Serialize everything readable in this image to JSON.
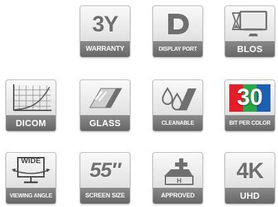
{
  "tiles": [
    {
      "id": "warranty",
      "title": "3Y",
      "label": "WARRANTY"
    },
    {
      "id": "displayport",
      "label": "DISPLAY PORT"
    },
    {
      "id": "blos",
      "label": "BLOS"
    },
    {
      "id": "dicom",
      "label": "DICOM"
    },
    {
      "id": "glass",
      "label": "GLASS"
    },
    {
      "id": "cleanable",
      "label": "CLEANABLE"
    },
    {
      "id": "bitpercolor",
      "title": "30",
      "label": "BIT PER COLOR"
    },
    {
      "id": "wide",
      "title": "WIDE",
      "label": "VIEWING ANGLE"
    },
    {
      "id": "screensize",
      "title": "55″",
      "label": "SCREEN SIZE"
    },
    {
      "id": "approved",
      "label": "APPROVED"
    },
    {
      "id": "uhd",
      "title": "4K",
      "label": "UHD"
    }
  ],
  "colors": {
    "tile_label_bg": "#6e6e6e",
    "icon_gray": "#6f6f6f",
    "red": "#e41e26",
    "green": "#2aa849",
    "blue": "#1f5fb3"
  },
  "icons": {
    "displayport": "displayport-logo-icon",
    "blos": "monitor-hourglass-icon",
    "dicom": "grid-curve-chart-icon",
    "glass": "glass-panel-icon",
    "cleanable": "drops-wiper-icon",
    "approved": "hospital-cross-icon"
  }
}
